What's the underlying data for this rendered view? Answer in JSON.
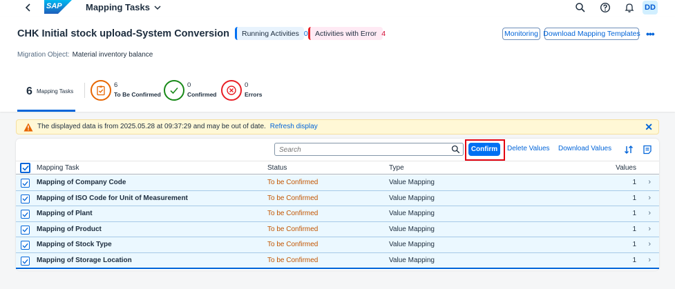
{
  "shell": {
    "logo_text": "SAP",
    "app_title": "Mapping Tasks",
    "avatar_initials": "DD"
  },
  "header": {
    "title": "CHK Initial stock upload-System Conversion",
    "running_label": "Running Activities",
    "running_count": "0",
    "error_label": "Activities with Error",
    "error_count": "4",
    "monitoring_label": "Monitoring",
    "download_templates_label": "Download Mapping Templates",
    "migration_object_label": "Migration Object:",
    "migration_object_value": "Material inventory balance"
  },
  "tabs": {
    "all_count": "6",
    "all_label": "Mapping Tasks",
    "to_confirm_count": "6",
    "to_confirm_label": "To Be Confirmed",
    "confirmed_count": "0",
    "confirmed_label": "Confirmed",
    "errors_count": "0",
    "errors_label": "Errors"
  },
  "message_strip": {
    "text": "The displayed data is from 2025.05.28 at 09:37:29 and may be out of date.",
    "link": "Refresh display"
  },
  "toolbar": {
    "search_placeholder": "Search",
    "confirm_label": "Confirm",
    "delete_label": "Delete Values",
    "download_label": "Download Values"
  },
  "table": {
    "columns": {
      "task": "Mapping Task",
      "status": "Status",
      "type": "Type",
      "values": "Values"
    },
    "rows": [
      {
        "task": "Mapping of Company Code",
        "status": "To be Confirmed",
        "type": "Value Mapping",
        "values": "1"
      },
      {
        "task": "Mapping of ISO Code for Unit of Measurement",
        "status": "To be Confirmed",
        "type": "Value Mapping",
        "values": "1"
      },
      {
        "task": "Mapping of Plant",
        "status": "To be Confirmed",
        "type": "Value Mapping",
        "values": "1"
      },
      {
        "task": "Mapping of Product",
        "status": "To be Confirmed",
        "type": "Value Mapping",
        "values": "1"
      },
      {
        "task": "Mapping of Stock Type",
        "status": "To be Confirmed",
        "type": "Value Mapping",
        "values": "1"
      },
      {
        "task": "Mapping of Storage Location",
        "status": "To be Confirmed",
        "type": "Value Mapping",
        "values": "1"
      }
    ]
  },
  "icons": {
    "back": "back-arrow-icon",
    "search": "search-icon",
    "help": "help-icon",
    "notifications": "bell-icon",
    "warning": "warning-icon",
    "sort": "sort-icon",
    "settings": "table-settings-icon"
  },
  "colors": {
    "brand": "#0070f2",
    "link": "#0064d9",
    "warning_text": "#c35500",
    "error": "#e81e25",
    "success": "#188918",
    "orange": "#e76500",
    "highlight_box": "#e3000f"
  }
}
